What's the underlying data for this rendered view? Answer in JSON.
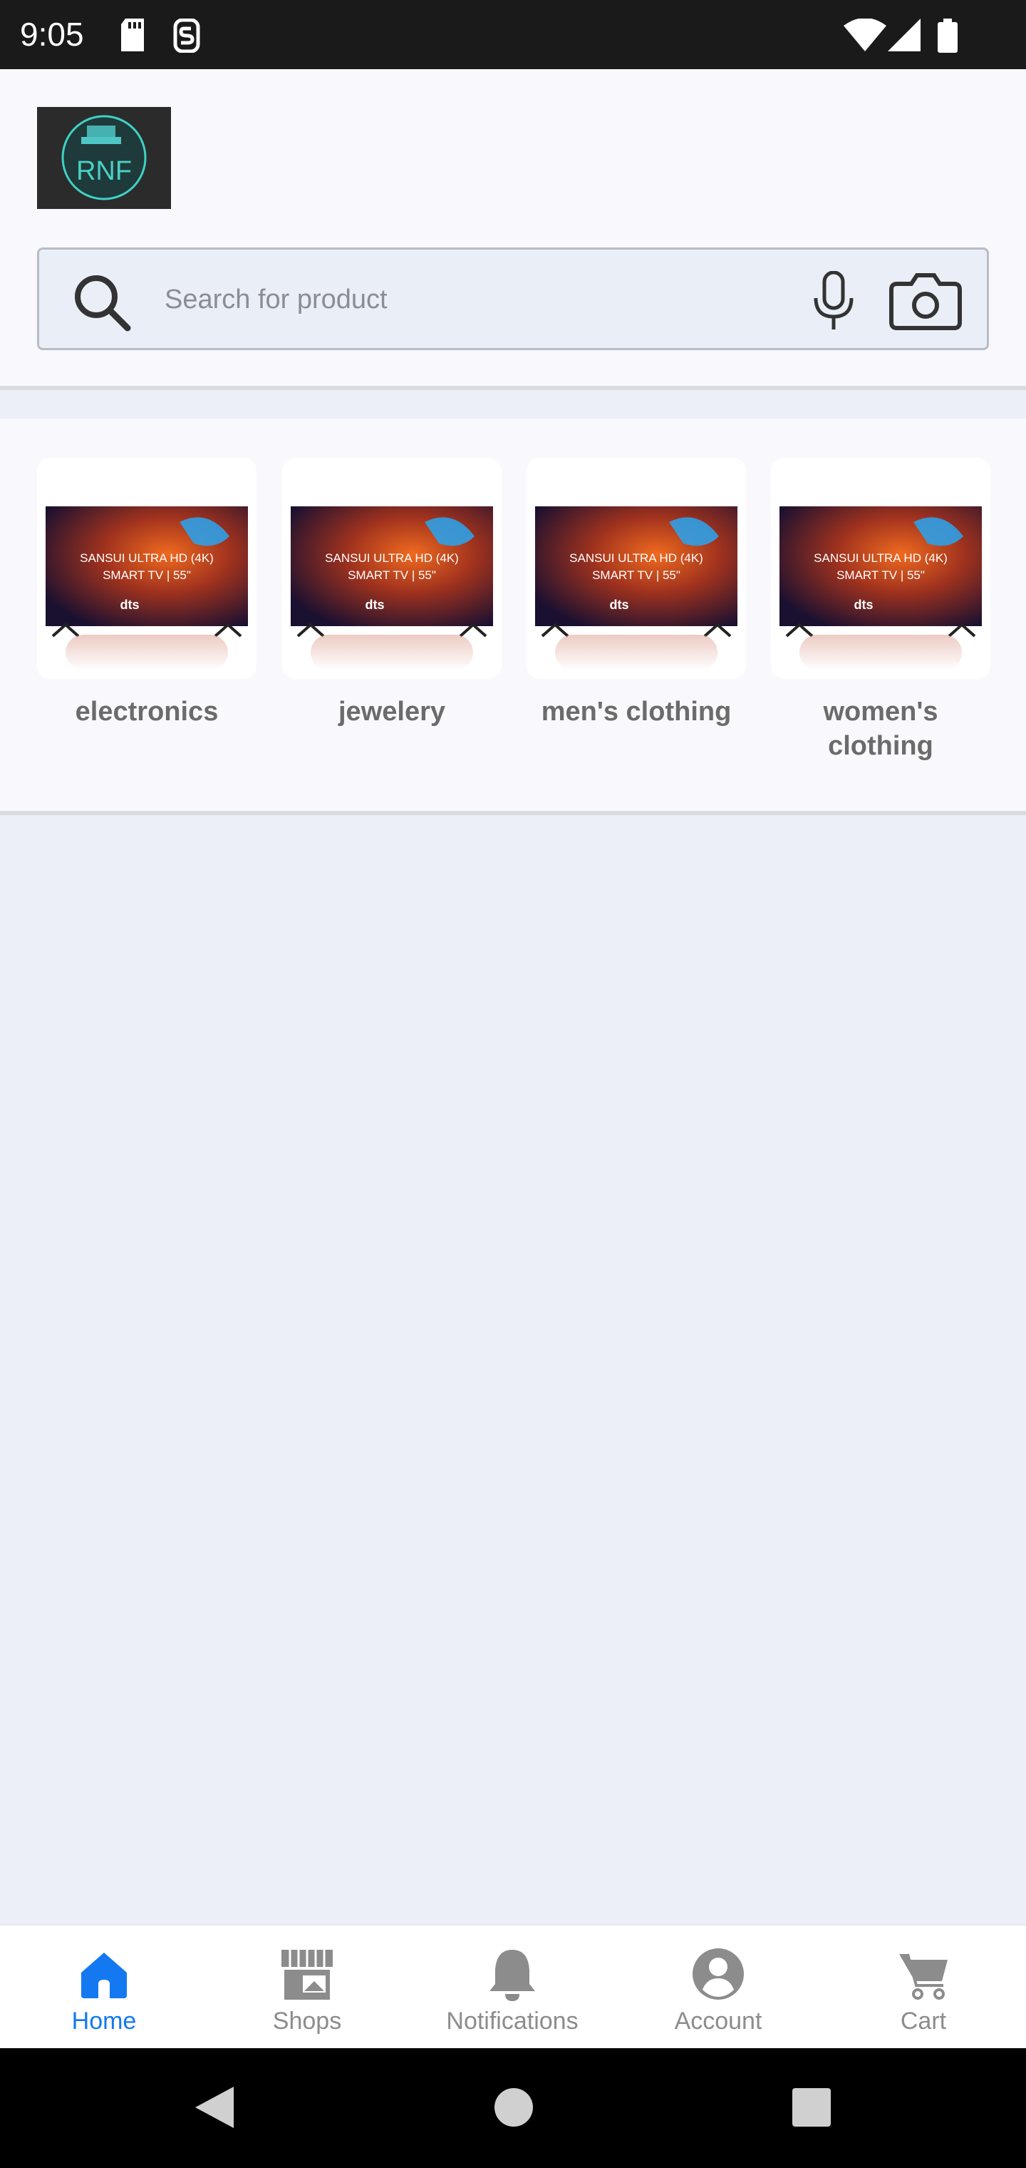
{
  "status_bar": {
    "time": "9:05",
    "icons": [
      "sd-card-icon",
      "s-icon",
      "wifi-icon",
      "signal-icon",
      "battery-icon"
    ]
  },
  "header": {
    "logo_text": "RNF",
    "search": {
      "placeholder": "Search for product",
      "value": ""
    },
    "icons": [
      "search-icon",
      "mic-icon",
      "camera-icon"
    ]
  },
  "categories": [
    {
      "label": "electronics",
      "image_text": "SANSUI ULTRA HD (4K) SMART TV | 55\""
    },
    {
      "label": "jewelery",
      "image_text": "SANSUI ULTRA HD (4K) SMART TV | 55\""
    },
    {
      "label": "men's clothing",
      "image_text": "SANSUI ULTRA HD (4K) SMART TV | 55\""
    },
    {
      "label": "women's clothing",
      "image_text": "SANSUI ULTRA HD (4K) SMART TV | 55\""
    }
  ],
  "bottom_nav": {
    "items": [
      {
        "label": "Home",
        "icon": "home-icon",
        "active": true
      },
      {
        "label": "Shops",
        "icon": "shop-icon",
        "active": false
      },
      {
        "label": "Notifications",
        "icon": "bell-icon",
        "active": false
      },
      {
        "label": "Account",
        "icon": "account-icon",
        "active": false
      },
      {
        "label": "Cart",
        "icon": "cart-icon",
        "active": false
      }
    ]
  },
  "colors": {
    "accent": "#1479f0",
    "inactive": "#8c8c8c",
    "background": "#eceff7"
  }
}
